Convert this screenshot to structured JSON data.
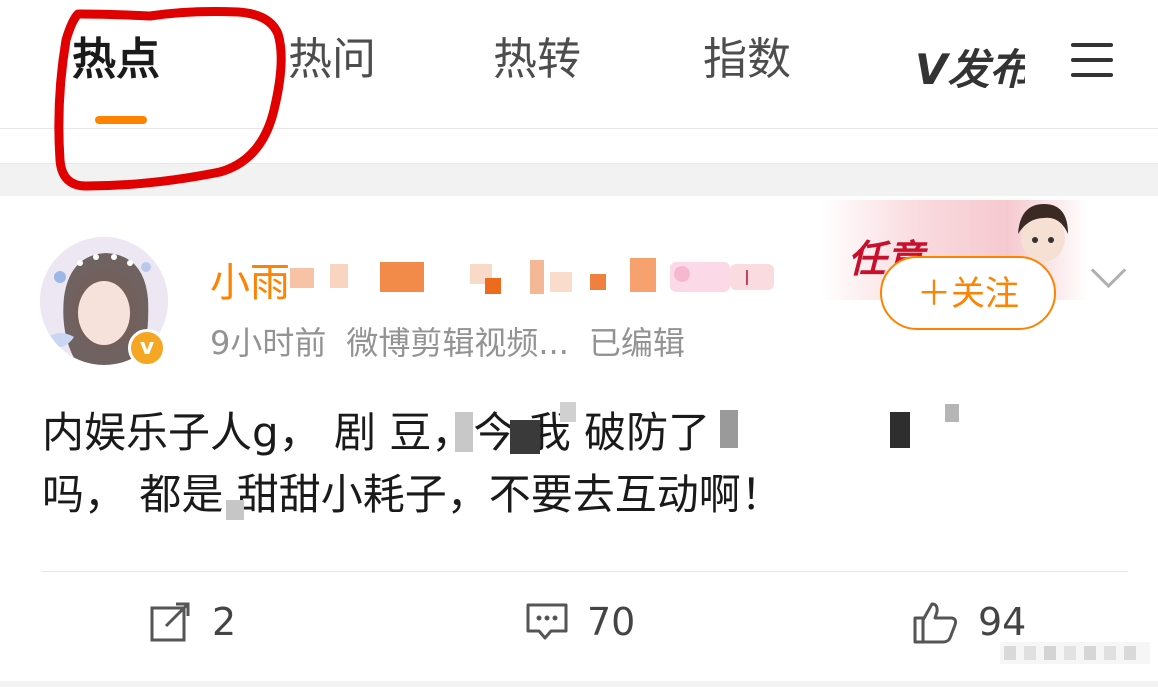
{
  "tabs": {
    "items": [
      {
        "label": "热点",
        "active": true
      },
      {
        "label": "热问",
        "active": false
      },
      {
        "label": "热转",
        "active": false
      },
      {
        "label": "指数",
        "active": false
      }
    ],
    "logo_text": "V发布",
    "menu_icon": "menu-icon",
    "accent": "#ff8200"
  },
  "post": {
    "username": "小雨",
    "verified_icon": "verified-badge-icon",
    "time": "9小时前",
    "source": "微博剪辑视频...",
    "edited": "已编辑",
    "decoration_text": "任意",
    "follow_label": "＋关注",
    "content_line1": "内娱乐子人g， 剧 豆，今 我 破防了",
    "content_line2": "吗， 都是 甜甜小耗子，不要去互动啊！",
    "actions": {
      "repost": {
        "icon": "repost-icon",
        "count": "2"
      },
      "comment": {
        "icon": "comment-icon",
        "count": "70"
      },
      "like": {
        "icon": "like-icon",
        "count": "94"
      }
    }
  },
  "colors": {
    "accent": "#ff8200",
    "annotation": "#e00000",
    "username": "#ff8200",
    "meta": "#939393"
  }
}
